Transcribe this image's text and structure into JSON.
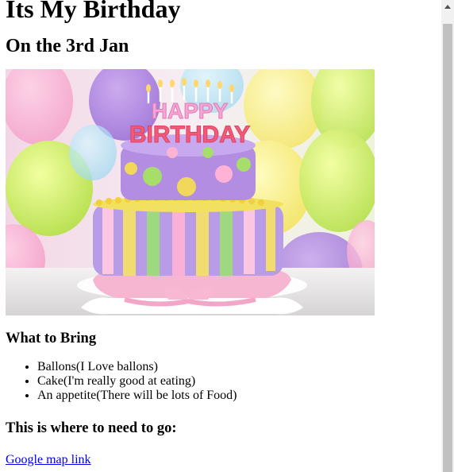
{
  "heading": "Its My Birthday",
  "date_heading": "On the 3rd Jan",
  "cake_lettering": "HAPPY BIRTHDAY",
  "bring_heading": "What to Bring",
  "bring_items": [
    "Ballons(I Love ballons)",
    "Cake(I'm really good at eating)",
    "An appetite(There will be lots of Food)"
  ],
  "where_heading": "This is where to need to go:",
  "map_link": "Google map link",
  "colors": {
    "link": "#0000ee",
    "scrollbar_track": "#f1f1f1",
    "scrollbar_thumb": "#c1c1c1"
  },
  "icons": {
    "scroll_up": "chevron-up-icon"
  }
}
